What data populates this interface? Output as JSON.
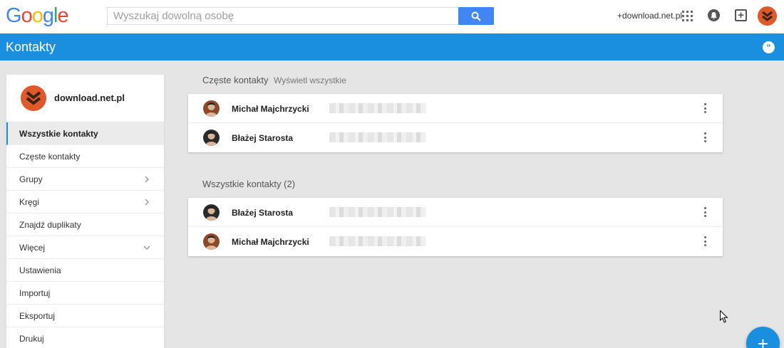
{
  "header": {
    "logo": "Google",
    "logo_colors": [
      "#4285f4",
      "#ea4335",
      "#fbbc05",
      "#4285f4",
      "#34a853",
      "#ea4335"
    ],
    "search_placeholder": "Wyszukaj dowolną osobę",
    "user_link": "+download.net.pl",
    "accent": "#4285f4"
  },
  "appbar": {
    "title": "Kontakty",
    "color": "#1a8fe0"
  },
  "sidebar": {
    "account_name": "download.net.pl",
    "items": [
      {
        "label": "Wszystkie kontakty",
        "active": true,
        "chevron": ""
      },
      {
        "label": "Częste kontakty",
        "chevron": ""
      },
      {
        "label": "Grupy",
        "chevron": "right"
      },
      {
        "label": "Kręgi",
        "chevron": "right"
      },
      {
        "label": "Znajdź duplikaty",
        "chevron": ""
      },
      {
        "label": "Więcej",
        "chevron": "down"
      },
      {
        "label": "Ustawienia",
        "chevron": ""
      },
      {
        "label": "Importuj",
        "chevron": ""
      },
      {
        "label": "Eksportuj",
        "chevron": ""
      },
      {
        "label": "Drukuj",
        "chevron": ""
      }
    ]
  },
  "frequent": {
    "heading": "Częste kontakty",
    "show_all": "Wyświetl wszystkie",
    "contacts": [
      {
        "name": "Michał Majchrzycki",
        "avatar_color": "#8a4a2a"
      },
      {
        "name": "Błażej Starosta",
        "avatar_color": "#2b2b2b"
      }
    ]
  },
  "all": {
    "heading": "Wszystkie kontakty (2)",
    "contacts": [
      {
        "name": "Błażej Starosta",
        "avatar_color": "#2b2b2b"
      },
      {
        "name": "Michał Majchrzycki",
        "avatar_color": "#8a4a2a"
      }
    ]
  },
  "fab": {
    "symbol": "+"
  }
}
